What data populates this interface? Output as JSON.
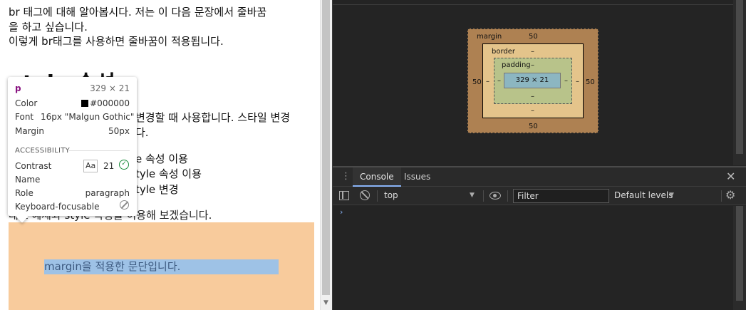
{
  "page": {
    "line1": "br 태그에 대해 알아봅시다. 저는 이 다음 문장에서 줄바꿈",
    "line2": "을 하고 싶습니다.",
    "line3": "이렇게 br태그를 사용하면 줄바꿈이 적용됩니다.",
    "heading": "style 속성",
    "para_line1": "변경할 때 사용합니다. 스타일 변경",
    "para_line2": "다.",
    "item1": "e 속성 이용",
    "item2": "tyle 속성 이용",
    "item3": "tyle 변경",
    "intro": "대표 예제와 style 속성을 이용해 보겠습니다.",
    "margin_paragraph": "margin을 적용한 문단입니다."
  },
  "tooltip": {
    "tag": "p",
    "size": "329 × 21",
    "color_label": "Color",
    "color_value": "#000000",
    "font_label": "Font",
    "font_value": "16px \"Malgun Gothic\"",
    "margin_label": "Margin",
    "margin_value": "50px",
    "accessibility_heading": "ACCESSIBILITY",
    "contrast_label": "Contrast",
    "contrast_aa": "Aa",
    "contrast_value": "21",
    "name_label": "Name",
    "role_label": "Role",
    "role_value": "paragraph",
    "keyboard_label": "Keyboard-focusable"
  },
  "box_model": {
    "margin_label": "margin",
    "margin_top": "50",
    "margin_bottom": "50",
    "margin_left": "50",
    "margin_right": "50",
    "border_label": "border",
    "border_top": "–",
    "border_bottom": "–",
    "border_left": "–",
    "border_right": "–",
    "padding_label": "padding",
    "padding_top": "–",
    "padding_bottom": "–",
    "padding_left": "–",
    "padding_right": "–",
    "content": "329 × 21"
  },
  "drawer": {
    "tabs": [
      {
        "label": "Console",
        "active": true
      },
      {
        "label": "Issues",
        "active": false
      }
    ]
  },
  "console": {
    "context": "top",
    "filter_placeholder": "Filter",
    "levels": "Default levels",
    "prompt": "›"
  },
  "colors": {
    "margin_box": "#ae8152",
    "border_box": "#e4c48b",
    "padding_box": "#b8c38a",
    "content_box": "#8cb6c1",
    "page_margin_highlight": "#f8cb9c",
    "page_content_highlight": "#9ec2e6",
    "tab_accent": "#8ab4f8",
    "contrast_ok": "#1e8e3e"
  }
}
